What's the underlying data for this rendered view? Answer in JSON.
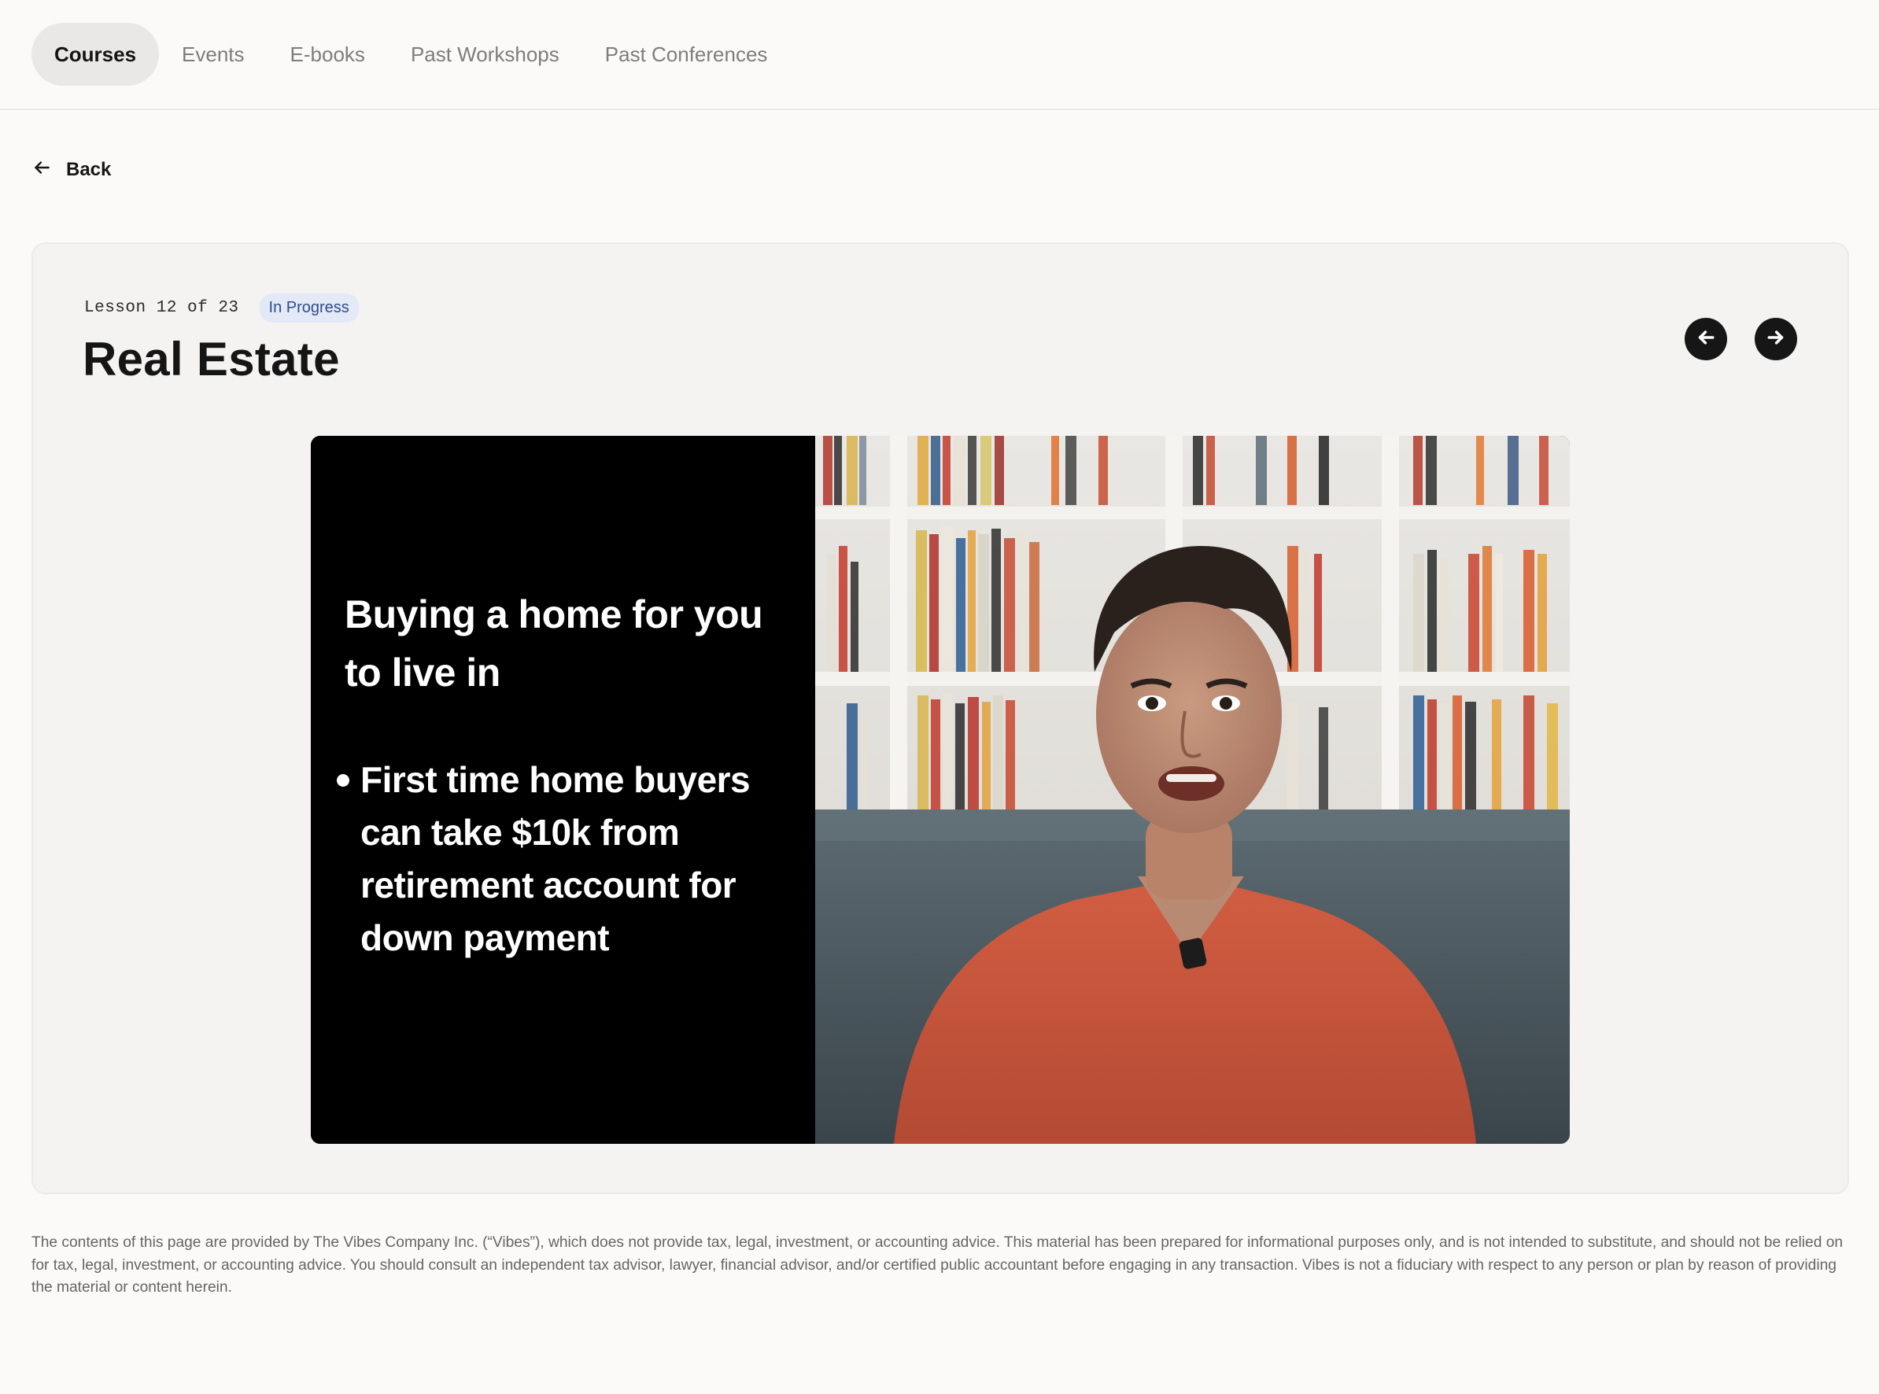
{
  "nav": {
    "tabs": [
      {
        "label": "Courses",
        "active": true
      },
      {
        "label": "Events",
        "active": false
      },
      {
        "label": "E-books",
        "active": false
      },
      {
        "label": "Past Workshops",
        "active": false
      },
      {
        "label": "Past Conferences",
        "active": false
      }
    ]
  },
  "back": {
    "label": "Back",
    "icon": "arrow-left-icon"
  },
  "lesson": {
    "counter": "Lesson 12 of 23",
    "status": "In Progress",
    "title": "Real Estate",
    "prev_icon": "arrow-left-circle-icon",
    "next_icon": "arrow-right-circle-icon"
  },
  "video": {
    "slide_heading": "Buying a home for you to live in",
    "slide_bullet": "First time home buyers can take $10k from retirement account for down payment"
  },
  "disclaimer": "The contents of this page are provided by The Vibes Company Inc. (“Vibes”), which does not provide tax, legal, investment, or accounting advice. This material has been prepared for informational purposes only, and is not intended to substitute, and should not be relied on for tax, legal, investment, or accounting advice. You should consult an independent tax advisor, lawyer, financial advisor, and/or certified public accountant before engaging in any transaction. Vibes is not a fiduciary with respect to any person or plan by reason of providing the material or content herein.",
  "colors": {
    "page_bg": "#fbfaf8",
    "card_bg": "#f4f3f1",
    "badge_bg": "#e3e9f6",
    "badge_text": "#2d4d8e",
    "shirt": "#c9553a"
  }
}
